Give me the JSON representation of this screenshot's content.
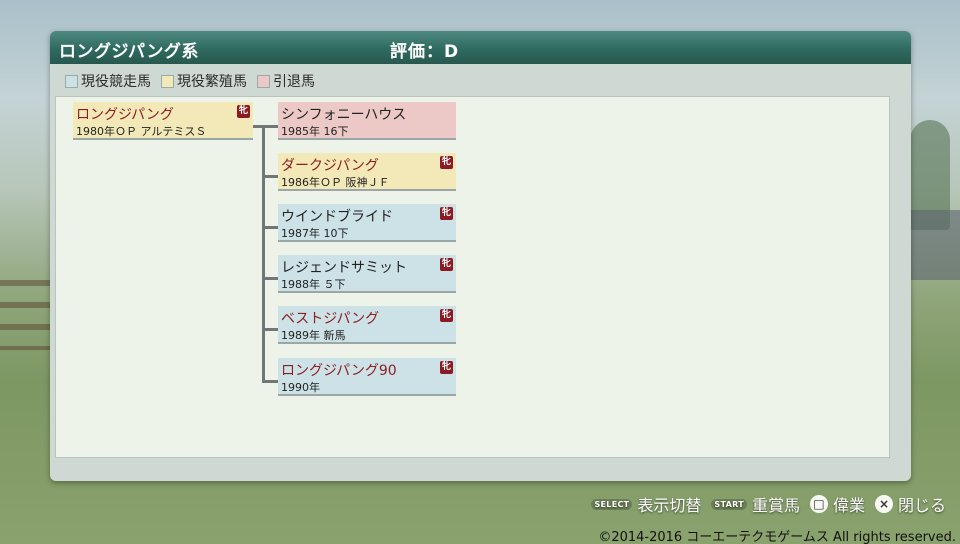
{
  "panel": {
    "title": "ロングジパング系",
    "rating": "評価：D"
  },
  "legend": [
    {
      "label": "現役競走馬",
      "color": "#cde2e6"
    },
    {
      "label": "現役繁殖馬",
      "color": "#f3e9b8"
    },
    {
      "label": "引退馬",
      "color": "#ecc9c7"
    }
  ],
  "root": {
    "name": "ロングジパング",
    "record": "1980年ＯＰ アルテミスＳ",
    "status": "breed",
    "badge": "牝"
  },
  "children": [
    {
      "name": "シンフォニーハウス",
      "record": "1985年 16下",
      "status": "retired"
    },
    {
      "name": "ダークジパング",
      "record": "1986年ＯＰ 阪神ＪＦ",
      "status": "breed",
      "badge": "牝"
    },
    {
      "name": "ウインドブライド",
      "record": "1987年 10下",
      "status": "active",
      "badge": "牝"
    },
    {
      "name": "レジェンドサミット",
      "record": "1988年 ５下",
      "status": "active",
      "badge": "牝"
    },
    {
      "name": "ベストジパング",
      "record": "1989年 新馬",
      "status": "active",
      "badge": "牝"
    },
    {
      "name": "ロングジパング90",
      "record": "1990年",
      "status": "active",
      "badge": "牝"
    }
  ],
  "controls": {
    "select_tag": "SELECT",
    "select_label": "表示切替",
    "start_tag": "START",
    "start_label": "重賞馬",
    "square_symbol": "□",
    "square_label": "偉業",
    "cross_symbol": "×",
    "cross_label": "閉じる"
  },
  "copyright": "©2014-2016 コーエーテクモゲームス All rights reserved."
}
